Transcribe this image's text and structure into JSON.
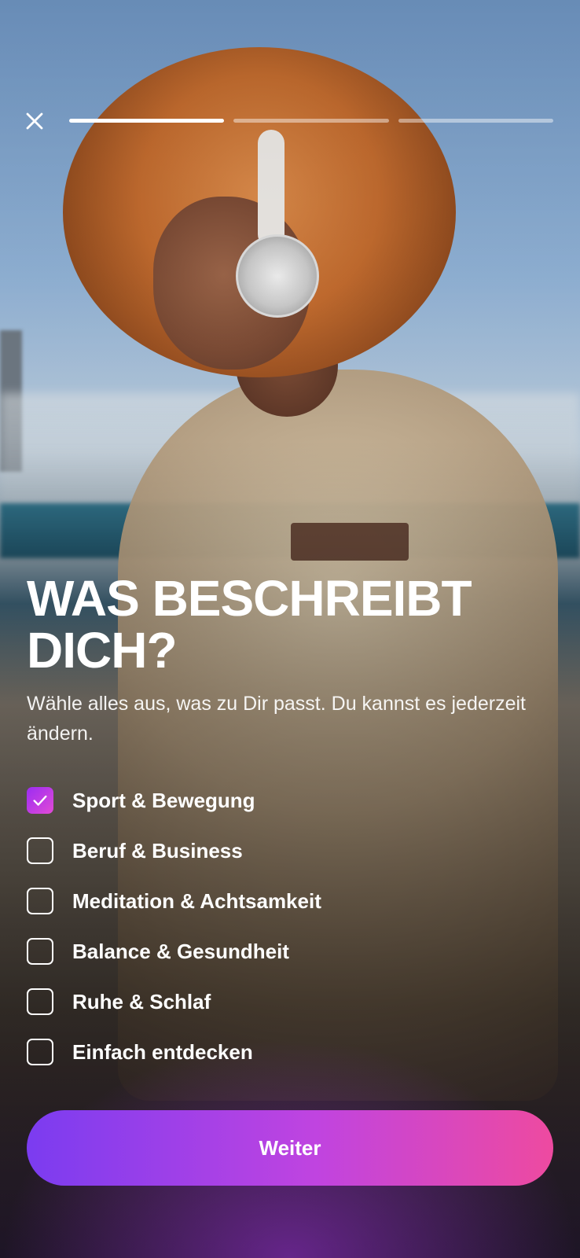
{
  "header": {
    "close_icon": "close-icon",
    "progress": {
      "steps": 3,
      "current_step": 1
    }
  },
  "main": {
    "title": "WAS BESCHREIBT DICH?",
    "subtitle": "Wähle alles aus, was zu Dir passt. Du kannst es jederzeit ändern.",
    "options": [
      {
        "label": "Sport & Bewegung",
        "checked": true
      },
      {
        "label": "Beruf & Business",
        "checked": false
      },
      {
        "label": "Meditation & Achtsamkeit",
        "checked": false
      },
      {
        "label": "Balance & Gesundheit",
        "checked": false
      },
      {
        "label": "Ruhe & Schlaf",
        "checked": false
      },
      {
        "label": "Einfach entdecken",
        "checked": false
      }
    ]
  },
  "footer": {
    "continue_label": "Weiter"
  },
  "colors": {
    "accent_gradient_start": "#7b3cf0",
    "accent_gradient_end": "#ee4aa0",
    "checkbox_checked": "#c044e0"
  }
}
